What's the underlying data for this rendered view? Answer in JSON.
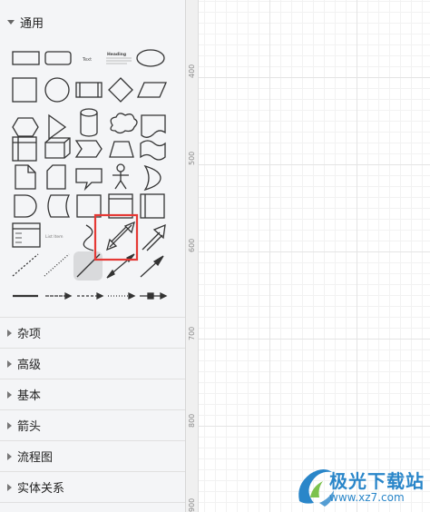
{
  "panel": {
    "general_section": {
      "label": "通用",
      "expanded": true
    },
    "collapsed_sections": [
      {
        "label": "杂项"
      },
      {
        "label": "高级"
      },
      {
        "label": "基本"
      },
      {
        "label": "箭头"
      },
      {
        "label": "流程图"
      },
      {
        "label": "实体关系"
      }
    ],
    "shape_labels": {
      "text": "Text",
      "heading": "Heading",
      "list_item": "List Item"
    },
    "highlighted_shape": "bidirectional-arrow",
    "highlight_color": "#e53935"
  },
  "canvas": {
    "ruler_labels": [
      "400",
      "500",
      "600",
      "700",
      "800",
      "900"
    ]
  },
  "watermark": {
    "text": "极光下载站",
    "url": "www.xz7.com",
    "color": "#2a86c9"
  }
}
